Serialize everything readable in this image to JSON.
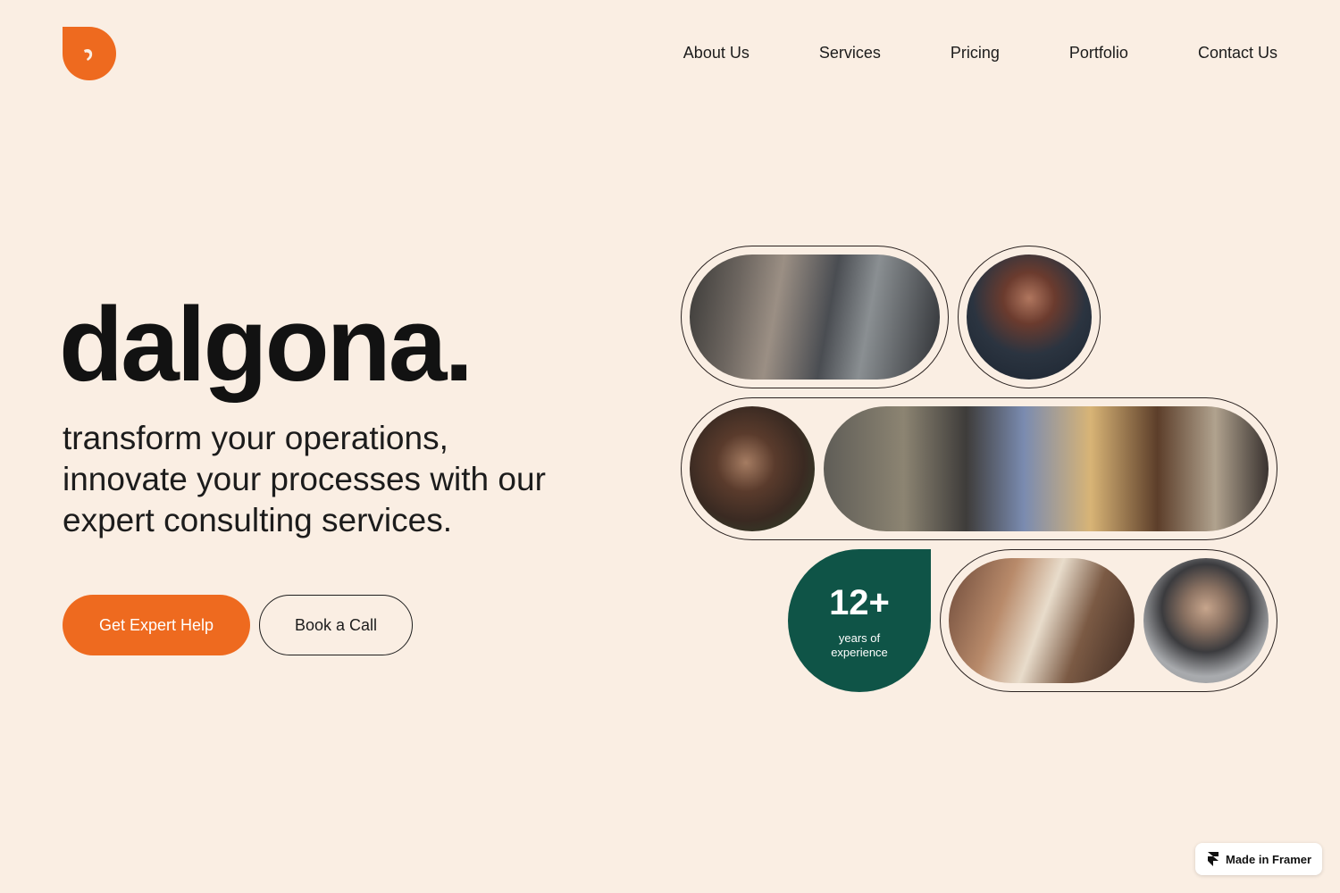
{
  "nav": {
    "items": [
      "About Us",
      "Services",
      "Pricing",
      "Portfolio",
      "Contact Us"
    ]
  },
  "hero": {
    "brand": "dalgona.",
    "tagline": "transform your operations, innovate your processes with our expert consulting services.",
    "primary_cta": "Get Expert Help",
    "secondary_cta": "Book a Call"
  },
  "stat": {
    "value": "12+",
    "label_line1": "years of",
    "label_line2": "experience"
  },
  "badge": {
    "label": "Made in Framer"
  },
  "colors": {
    "background": "#faeee3",
    "accent": "#ee6a1f",
    "stat_green": "#0f5447"
  },
  "icons": {
    "logo": "dalgona-logo-icon",
    "framer": "framer-icon"
  }
}
